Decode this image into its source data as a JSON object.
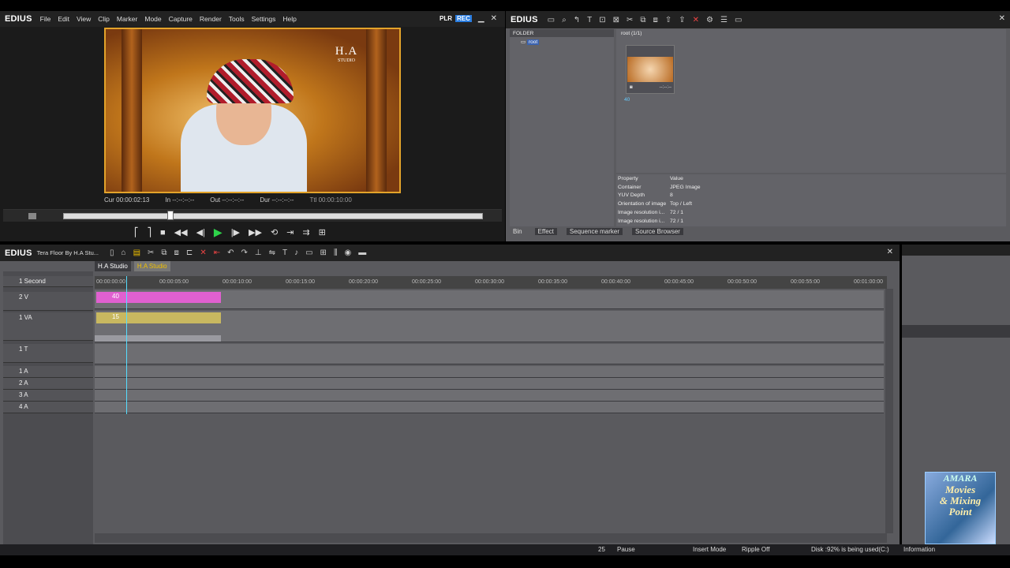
{
  "player": {
    "app_logo": "EDIUS",
    "menu": [
      "File",
      "Edit",
      "View",
      "Clip",
      "Marker",
      "Mode",
      "Capture",
      "Render",
      "Tools",
      "Settings",
      "Help"
    ],
    "plr": "PLR",
    "rec": "REC",
    "preview_stamp_big": "H.A",
    "preview_stamp_name": "STUDIO",
    "timecodes": {
      "cur": "Cur 00:00:02:13",
      "in": "In --:--:--:--",
      "out": "Out --:--:--:--",
      "dur": "Dur --:--:--:--",
      "ttl": "Ttl 00:00:10:00"
    },
    "scrub_position": 0.25
  },
  "bin": {
    "app_logo": "EDIUS",
    "folder_header": "FOLDER",
    "folder_root": "root",
    "clips_header": "root (1/1)",
    "clip_number": "40",
    "clip_timecode": "--:--:--",
    "props_headers": [
      "Property",
      "Value"
    ],
    "props": [
      [
        "Container",
        "JPEG Image"
      ],
      [
        "YUV Depth",
        "8"
      ],
      [
        "Orientation of image",
        "Top / Left"
      ],
      [
        "Image resolution i...",
        "72 / 1"
      ],
      [
        "Image resolution i...",
        "72 / 1"
      ]
    ],
    "tabs": [
      "Bin",
      "Effect",
      "Sequence marker",
      "Source Browser"
    ]
  },
  "timeline": {
    "app_logo": "EDIUS",
    "project_title": "Tera Floor By H.A Stu...",
    "sequence_tabs": [
      "H.A Studio",
      "H.A Studio"
    ],
    "scale_label": "1 Second",
    "ruler": [
      "00:00:00:00",
      "00:00:05:00",
      "00:00:10:00",
      "00:00:15:00",
      "00:00:20:00",
      "00:00:25:00",
      "00:00:30:00",
      "00:00:35:00",
      "00:00:40:00",
      "00:00:45:00",
      "00:00:50:00",
      "00:00:55:00",
      "00:01:00:00"
    ],
    "tracks": [
      {
        "name": "2 V"
      },
      {
        "name": "1 VA"
      },
      {
        "name": "1 T"
      },
      {
        "name": "1 A"
      },
      {
        "name": "2 A"
      },
      {
        "name": "3 A"
      },
      {
        "name": "4 A"
      }
    ],
    "clip_v_label": "40",
    "clip_va_label": "15"
  },
  "status": {
    "frames": "25",
    "pause": "Pause",
    "insert_mode": "Insert Mode",
    "ripple": "Ripple Off",
    "disk": "Disk :92% is being used(C:)"
  },
  "side_panel": {
    "information_tab": "Information"
  },
  "watermark": {
    "line1": "AMARA",
    "line2": "Movies",
    "line3": "& Mixing",
    "line4": "Point"
  }
}
